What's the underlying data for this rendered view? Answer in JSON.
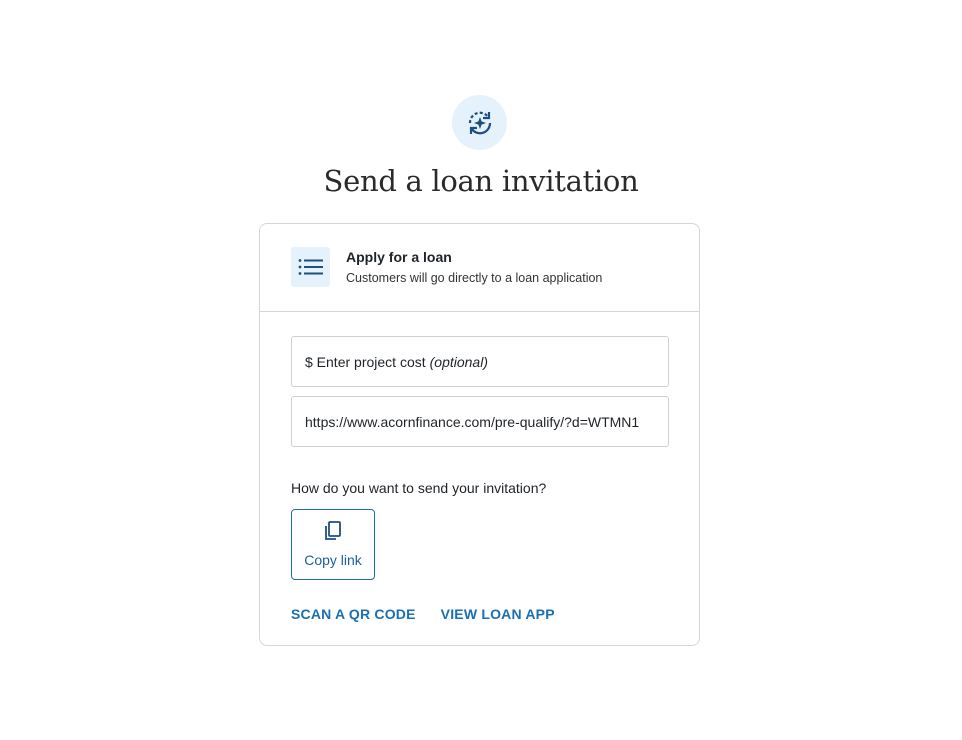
{
  "page": {
    "title": "Send a loan invitation",
    "hero_icon": "sparkle-refresh-icon"
  },
  "option": {
    "icon": "list-icon",
    "title": "Apply for a loan",
    "description": "Customers will go directly to a loan application"
  },
  "form": {
    "project_cost_label": "$ Enter project cost",
    "project_cost_optional": "(optional)",
    "url_value": "https://www.acornfinance.com/pre-qualify/?d=WTMN1"
  },
  "send": {
    "question": "How do you want to send your invitation?",
    "copy_link_label": "Copy link",
    "copy_icon": "copy-icon"
  },
  "links": {
    "scan_qr": "SCAN A QR CODE",
    "view_loan_app": "VIEW LOAN APP"
  },
  "colors": {
    "accent": "#1a6fb5",
    "icon_bg": "#e6f2fb",
    "border": "#d6d6d6"
  }
}
